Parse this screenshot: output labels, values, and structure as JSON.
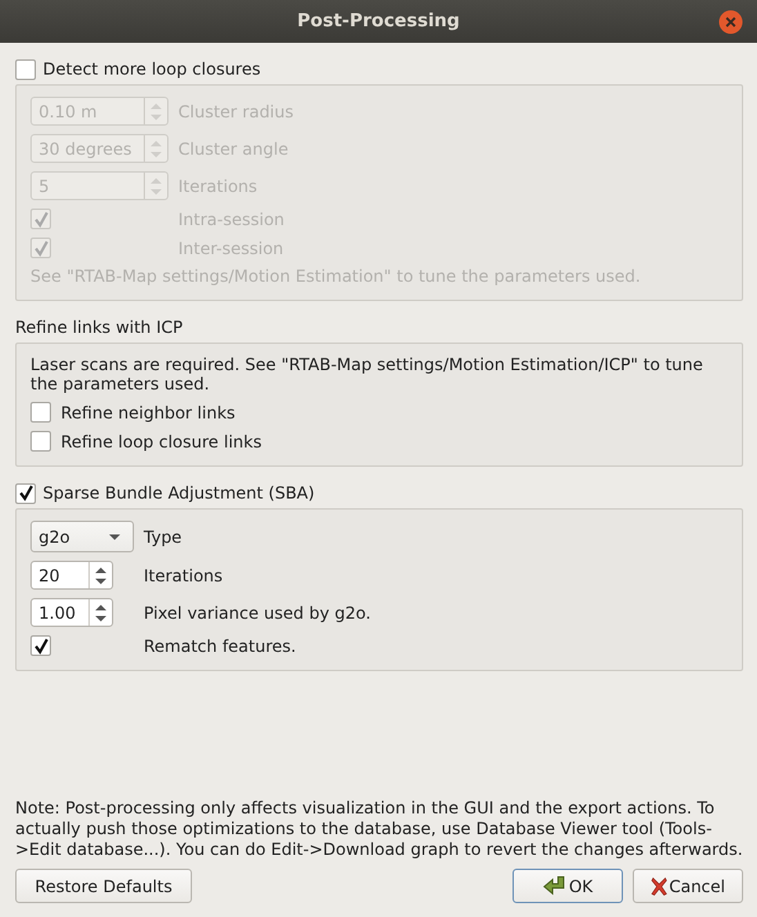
{
  "window": {
    "title": "Post-Processing"
  },
  "groups": [
    {
      "header": {
        "kind": "checkbox",
        "label": "Detect more loop closures",
        "checked": false
      },
      "disabled": true,
      "rows": [
        {
          "kind": "spin",
          "value": "0.10 m",
          "label": "Cluster radius"
        },
        {
          "kind": "spin",
          "value": "30 degrees",
          "label": "Cluster angle"
        },
        {
          "kind": "spin",
          "value": "5",
          "label": "Iterations"
        },
        {
          "kind": "check",
          "checked": true,
          "label": "Intra-session"
        },
        {
          "kind": "check",
          "checked": true,
          "label": "Inter-session"
        },
        {
          "kind": "note",
          "text": "See \"RTAB-Map settings/Motion Estimation\" to tune the parameters used."
        }
      ]
    },
    {
      "header": {
        "kind": "label",
        "label": "Refine links with ICP"
      },
      "disabled": false,
      "rows": [
        {
          "kind": "note",
          "text": "Laser scans are required. See \"RTAB-Map settings/Motion Estimation/ICP\" to tune the parameters used."
        },
        {
          "kind": "check",
          "checked": false,
          "label": "Refine neighbor links"
        },
        {
          "kind": "check",
          "checked": false,
          "label": "Refine loop closure links"
        }
      ]
    },
    {
      "header": {
        "kind": "checkbox",
        "label": "Sparse Bundle Adjustment (SBA)",
        "checked": true
      },
      "disabled": false,
      "rows": [
        {
          "kind": "combo",
          "value": "g2o",
          "label": "Type"
        },
        {
          "kind": "spin",
          "value": "20",
          "label": "Iterations"
        },
        {
          "kind": "spin",
          "value": "1.00",
          "label": "Pixel variance used by g2o."
        },
        {
          "kind": "check",
          "checked": true,
          "label": "Rematch features."
        }
      ]
    }
  ],
  "note": "Note: Post-processing only affects visualization in the GUI and the export actions. To actually push those optimizations to the database, use Database Viewer tool (Tools->Edit database...). You can do Edit->Download graph to revert the changes afterwards.",
  "buttons": [
    {
      "kind": "plain",
      "label": "Restore Defaults"
    },
    {
      "kind": "ok",
      "label": "OK"
    },
    {
      "kind": "cancel",
      "label": "Cancel"
    }
  ]
}
